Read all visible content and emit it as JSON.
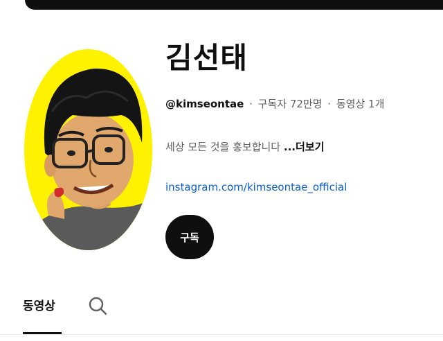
{
  "channel": {
    "name": "김선태",
    "handle": "@kimseontae",
    "subscribers": "구독자 72만명",
    "videos": "동영상 1개",
    "separator": "·",
    "description": "세상 모든 것을 홍보합니다",
    "more_label": "...더보기",
    "link": "instagram.com/kimseontae_official",
    "subscribe_label": "구독"
  },
  "tabs": {
    "videos_label": "동영상",
    "search_icon": "search-icon"
  },
  "colors": {
    "avatar_background": "#fff200",
    "link": "#065fd4",
    "subscribe_button": "#0f0f0f"
  }
}
